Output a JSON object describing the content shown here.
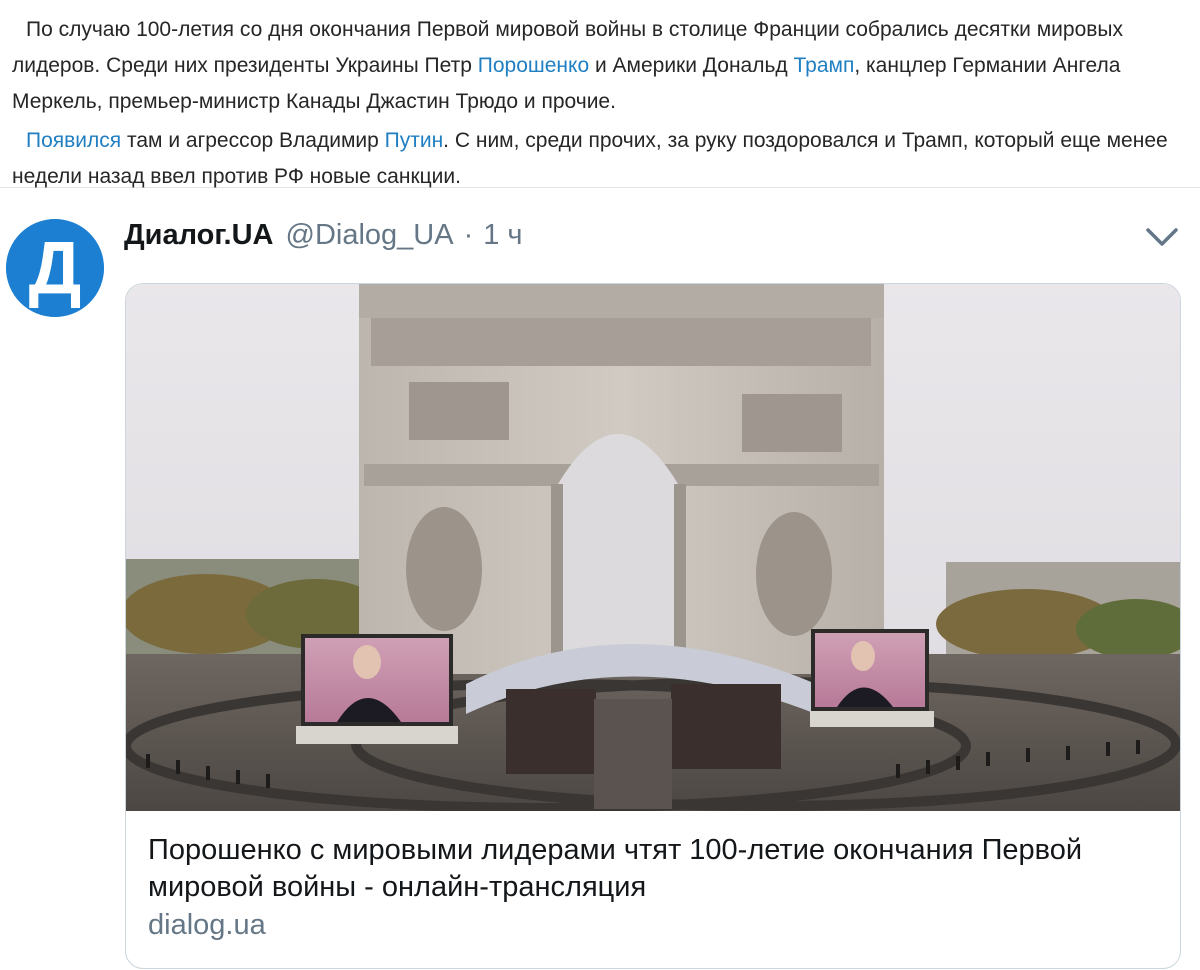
{
  "article": {
    "p1": {
      "t1": "По случаю 100-летия со дня окончания Первой мировой войны в столице Франции собрались десятки мировых лидеров. Среди них президенты Украины Петр ",
      "link1": "Порошенко",
      "t2": " и Америки Дональд ",
      "link2": "Трамп",
      "t3": ", канцлер Германии Ангела Меркель, премьер-министр Канады Джастин Трюдо и прочие."
    },
    "p2": {
      "link1": "Появился",
      "t1": " там и агрессор Владимир ",
      "link2": "Путин",
      "t2": ". С ним, среди прочих, за руку поздоровался и Трамп, который еще менее недели назад ввел против РФ новые санкции."
    },
    "link_color": "#1f7fc2"
  },
  "tweet": {
    "avatar_letter": "Д",
    "avatar_color": "#1d7fd1",
    "name": "Диалог.UA",
    "handle": "@Dialog_UA",
    "separator": "·",
    "time": "1 ч",
    "menu_icon": "chevron-down-icon",
    "card": {
      "image_icon": "arc-de-triomphe-photo",
      "title": "Порошенко с мировыми лидерами чтят 100-летие окончания Первой мировой войны - онлайн-трансляция",
      "domain": "dialog.ua"
    }
  }
}
